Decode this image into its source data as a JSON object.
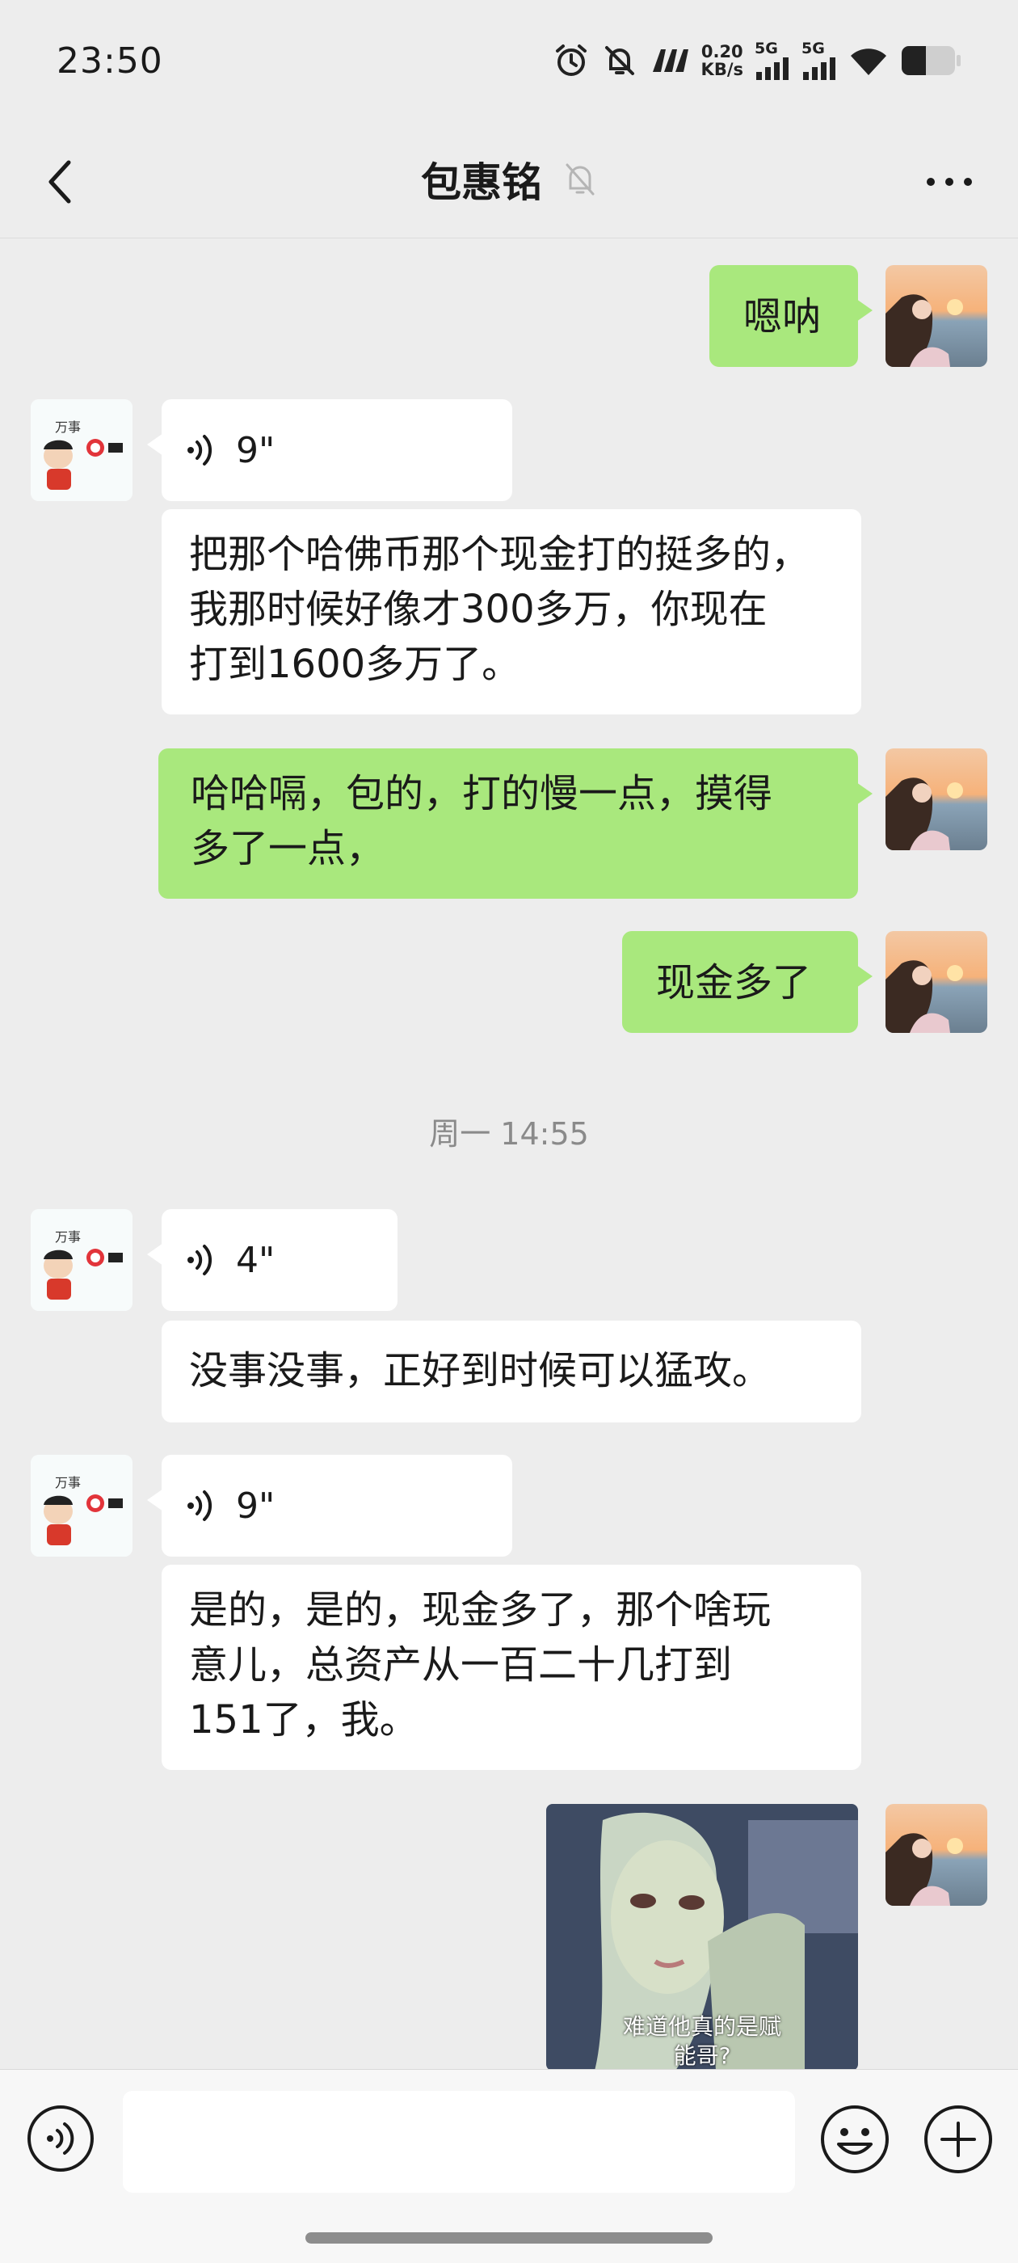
{
  "status_bar": {
    "time": "23:50",
    "net_speed_value": "0.20",
    "net_speed_unit": "KB/s",
    "signal_1_label": "5G",
    "signal_2_label": "5G",
    "icons": [
      "alarm-icon",
      "mute-icon",
      "nfc-icon",
      "signal-icon",
      "signal-icon",
      "wifi-icon",
      "battery-icon"
    ],
    "battery_level": 0.45
  },
  "header": {
    "title": "包惠铭",
    "icons": [
      "back-arrow-icon",
      "bell-off-icon",
      "more-icon"
    ]
  },
  "messages": [
    {
      "side": "right",
      "type": "text",
      "text": "嗯呐"
    },
    {
      "side": "left",
      "type": "voice",
      "duration": "9\""
    },
    {
      "side": "left",
      "type": "text",
      "lines": [
        "把那个哈佛币那个现金打的挺多的，",
        "我那时候好像才300多万，你现在",
        "打到1600多万了。"
      ]
    },
    {
      "side": "right",
      "type": "text",
      "lines": [
        "哈哈嗝，包的，打的慢一点，摸得",
        "多了一点，"
      ]
    },
    {
      "side": "right",
      "type": "text",
      "text": "现金多了"
    },
    {
      "type": "timestamp",
      "text": "周一 14:55"
    },
    {
      "side": "left",
      "type": "voice",
      "duration": "4\""
    },
    {
      "side": "left",
      "type": "text",
      "text": "没事没事，正好到时候可以猛攻。"
    },
    {
      "side": "left",
      "type": "voice",
      "duration": "9\""
    },
    {
      "side": "left",
      "type": "text",
      "lines": [
        "是的，是的，现金多了，那个啥玩",
        "意儿，总资产从一百二十几打到",
        "151了，我。"
      ]
    },
    {
      "side": "right",
      "type": "media",
      "caption_lines": [
        "难道他真的是赋",
        "能哥?"
      ]
    }
  ],
  "colors": {
    "background": "#ededed",
    "bubble_green": "#a9e87d",
    "bubble_white": "#ffffff",
    "timestamp_text": "#8a8a8a"
  },
  "bottom_bar": {
    "icons": [
      "voice-mode-icon",
      "emoji-icon",
      "plus-icon"
    ],
    "input_value": ""
  }
}
